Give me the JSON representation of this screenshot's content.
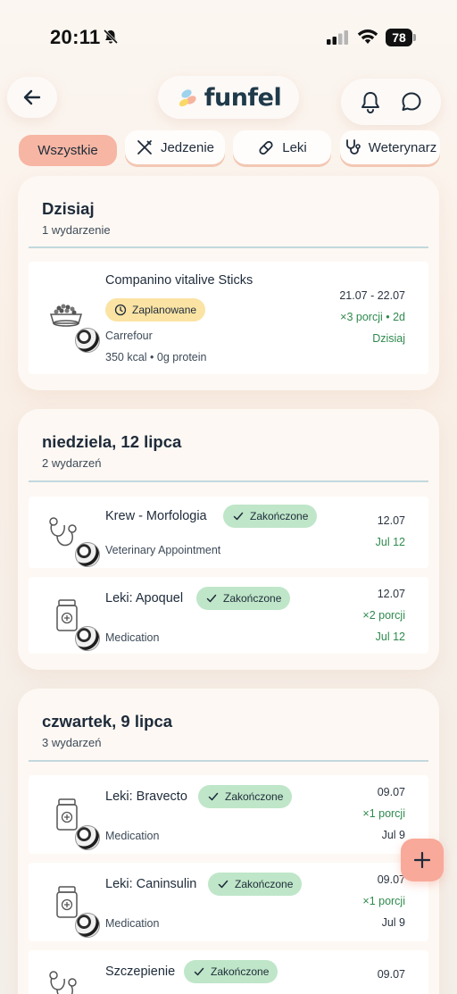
{
  "status_bar": {
    "time": "20:11",
    "battery": "78"
  },
  "header": {
    "logo": "funfel"
  },
  "filters": [
    {
      "label": "Wszystkie",
      "active": true
    },
    {
      "label": "Jedzenie",
      "icon": "utensils-icon"
    },
    {
      "label": "Leki",
      "icon": "pill-icon"
    },
    {
      "label": "Weterynarz",
      "icon": "stethoscope-icon"
    }
  ],
  "groups": [
    {
      "title": "Dzisiaj",
      "count": "1 wydarzenie",
      "items": [
        {
          "title": "Companino vitalive Sticks",
          "icon": "food-bowl-icon",
          "badge": "Zaplanowane",
          "line1": "Carrefour",
          "line2": "350 kcal • 0g protein",
          "right1": "21.07 - 22.07",
          "right2": "×3 porcji • 2d",
          "right3": "Dzisiaj"
        }
      ]
    },
    {
      "title": "niedziela, 12 lipca",
      "count": "2 wydarzeń",
      "items": [
        {
          "title": "Krew - Morfologia",
          "icon": "stethoscope-icon",
          "badge": "Zakończone",
          "line1": "Veterinary Appointment",
          "right1": "12.07",
          "right2": "Jul 12"
        },
        {
          "title": "Leki: Apoquel",
          "icon": "medicine-bottle-icon",
          "badge": "Zakończone",
          "line1": "Medication",
          "right1": "12.07",
          "right2": "×2 porcji",
          "right3": "Jul 12"
        }
      ]
    },
    {
      "title": "czwartek, 9 lipca",
      "count": "3 wydarzeń",
      "items": [
        {
          "title": "Leki: Bravecto",
          "icon": "medicine-bottle-icon",
          "badge": "Zakończone",
          "line1": "Medication",
          "right1": "09.07",
          "right2": "×1 porcji",
          "right3": "Jul 9"
        },
        {
          "title": "Leki: Caninsulin",
          "icon": "medicine-bottle-icon",
          "badge": "Zakończone",
          "line1": "Medication",
          "right1": "09.07",
          "right2": "×1 porcji",
          "right3": "Jul 9"
        },
        {
          "title": "Szczepienie",
          "icon": "stethoscope-icon",
          "badge": "Zakończone",
          "right1": "09.07"
        }
      ]
    }
  ]
}
